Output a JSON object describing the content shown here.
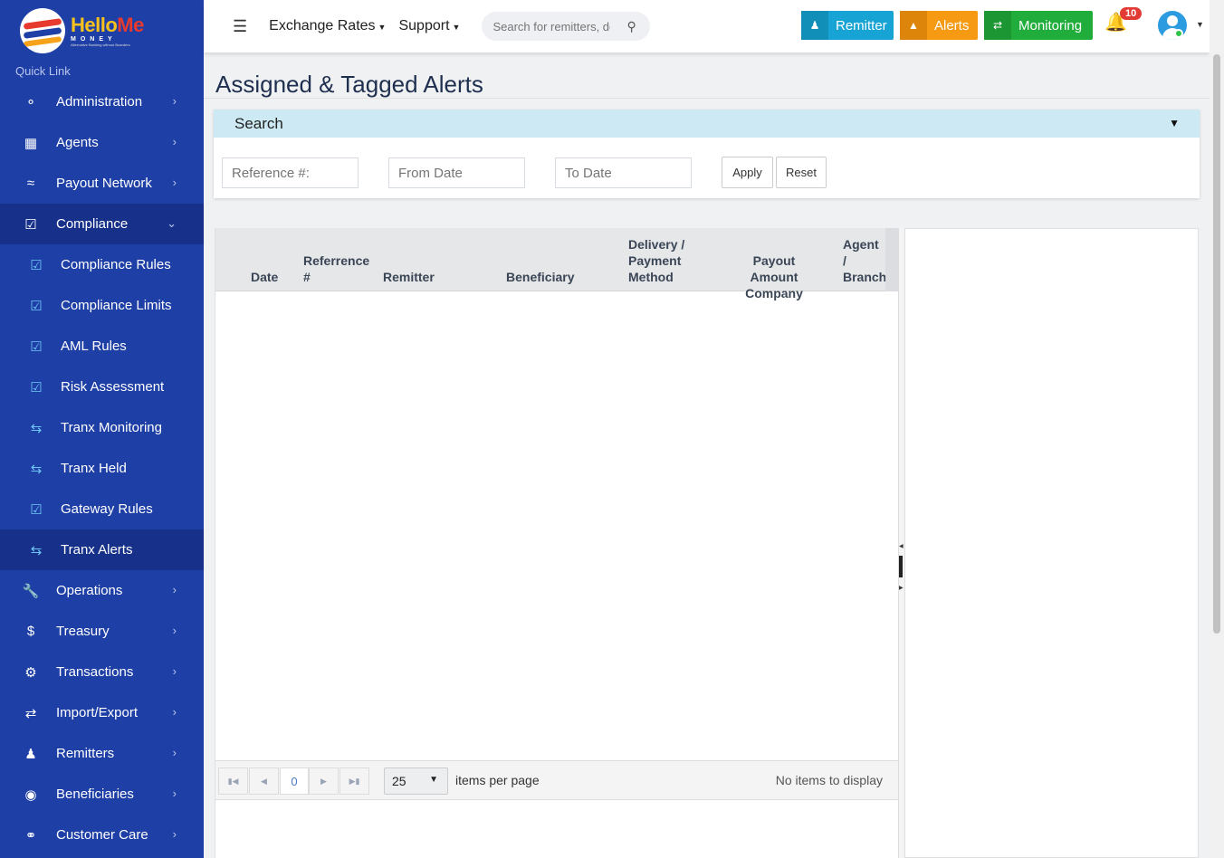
{
  "brand": {
    "name_a": "Hello",
    "name_b": "Me",
    "sub": "MONEY",
    "tagline": "Alternative Banking without Boarders"
  },
  "sidebar": {
    "quick_link": "Quick Link",
    "items": [
      {
        "label": "Administration",
        "icon": "settings-icon"
      },
      {
        "label": "Agents",
        "icon": "building-icon"
      },
      {
        "label": "Payout Network",
        "icon": "handshake-icon"
      },
      {
        "label": "Compliance",
        "icon": "check-square-icon"
      }
    ],
    "compliance_sub": [
      {
        "label": "Compliance Rules"
      },
      {
        "label": "Compliance Limits"
      },
      {
        "label": "AML Rules"
      },
      {
        "label": "Risk Assessment"
      },
      {
        "label": "Tranx Monitoring"
      },
      {
        "label": "Tranx Held"
      },
      {
        "label": "Gateway Rules"
      },
      {
        "label": "Tranx Alerts"
      }
    ],
    "items_after": [
      {
        "label": "Operations",
        "icon": "wrench-icon"
      },
      {
        "label": "Treasury",
        "icon": "dollar-icon"
      },
      {
        "label": "Transactions",
        "icon": "gears-icon"
      },
      {
        "label": "Import/Export",
        "icon": "shuffle-icon"
      },
      {
        "label": "Remitters",
        "icon": "users-icon"
      },
      {
        "label": "Beneficiaries",
        "icon": "user-circle-icon"
      },
      {
        "label": "Customer Care",
        "icon": "headset-icon"
      }
    ]
  },
  "topbar": {
    "menu_exchange": "Exchange Rates",
    "menu_support": "Support",
    "search_placeholder": "Search for remitters, de",
    "btn_remitter": "Remitter",
    "btn_alerts": "Alerts",
    "btn_monitoring": "Monitoring",
    "notif_count": "10"
  },
  "page": {
    "title": "Assigned & Tagged Alerts"
  },
  "search_panel": {
    "header": "Search",
    "reference_placeholder": "Reference #:",
    "from_placeholder": "From Date",
    "to_placeholder": "To Date",
    "apply": "Apply",
    "reset": "Reset"
  },
  "grid": {
    "headers": {
      "date": "Date",
      "ref_1": "Referrence",
      "ref_2": "#",
      "remitter": "Remitter",
      "beneficiary": "Beneficiary",
      "delivery_1": "Delivery /",
      "delivery_2": "Payment",
      "delivery_3": "Method",
      "payout_1": "Payout",
      "payout_2": "Amount Company",
      "agent_1": "Agent",
      "agent_2": "/",
      "agent_3": "Branch"
    },
    "rows": [],
    "pager": {
      "page": "0",
      "page_size": "25",
      "items_per_page": "items per page",
      "status": "No items to display"
    }
  }
}
